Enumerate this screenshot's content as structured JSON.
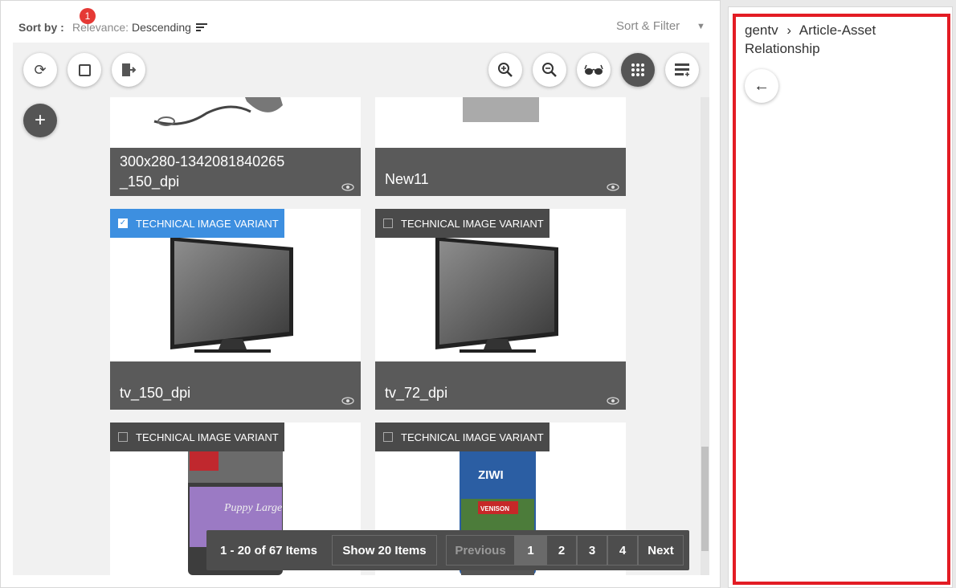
{
  "sort_bar": {
    "label": "Sort by :",
    "field": "Relevance:",
    "direction": "Descending",
    "sort_filter": "Sort & Filter"
  },
  "toolbar": {
    "selection_badge": "1",
    "icons": [
      "refresh-icon",
      "select-all-icon",
      "export-icon",
      "zoom-in-icon",
      "zoom-out-icon",
      "preview-glasses-icon",
      "grid-view-icon",
      "list-view-icon",
      "add-icon"
    ]
  },
  "cards": [
    {
      "caption": "300x280-1342081840265\n_150_dpi"
    },
    {
      "caption": "New11"
    },
    {
      "caption": "tv_150_dpi",
      "tag": "TECHNICAL IMAGE VARIANT",
      "checked": true
    },
    {
      "caption": "tv_72_dpi",
      "tag": "TECHNICAL IMAGE VARIANT",
      "checked": false
    },
    {
      "tag": "TECHNICAL IMAGE VARIANT",
      "checked": false
    },
    {
      "tag": "TECHNICAL IMAGE VARIANT",
      "checked": false
    }
  ],
  "pager": {
    "summary": "1 - 20 of 67 Items",
    "show": "Show 20 Items",
    "previous": "Previous",
    "pages": [
      "1",
      "2",
      "3",
      "4"
    ],
    "next": "Next"
  },
  "right_panel": {
    "crumb_root": "gentv",
    "crumb_sep": "›",
    "crumb_leaf": "Article-Asset Relationship"
  },
  "colors": {
    "accent_blue": "#3d8fe0",
    "badge_red": "#e53935",
    "highlight_red": "#e31c24"
  }
}
